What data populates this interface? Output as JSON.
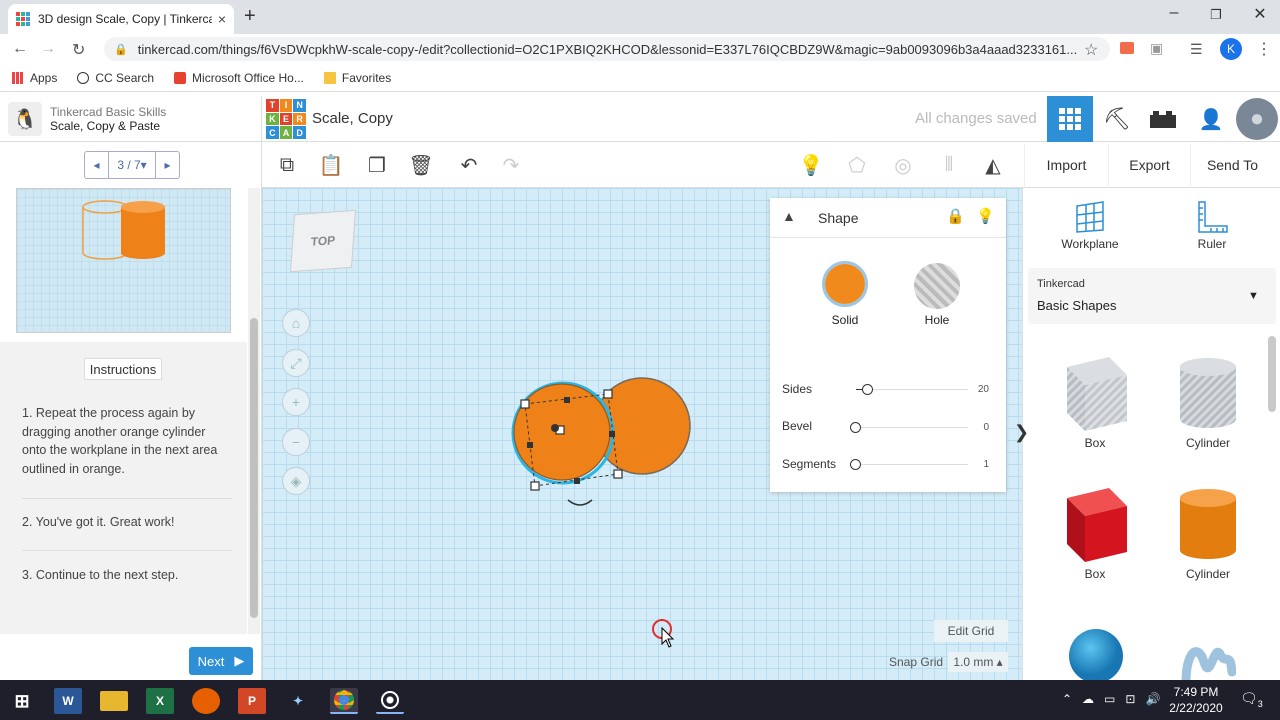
{
  "browser": {
    "tab_title": "3D design Scale, Copy | Tinkercad",
    "tab_close": "×",
    "new_tab": "+",
    "url": "tinkercad.com/things/f6VsDWcpkhW-scale-copy-/edit?collectionid=O2C1PXBIQ2KHCOD&lessonid=E337L76IQCBDZ9W&magic=9ab0093096b3a4aaad3233161...",
    "profile_initial": "K",
    "bookmarks": [
      "Apps",
      "CC Search",
      "Microsoft Office Ho...",
      "Favorites"
    ],
    "win_min": "–",
    "win_max": "❐",
    "win_close": "✕"
  },
  "lesson": {
    "course": "Tinkercad Basic Skills",
    "title": "Scale, Copy & Paste",
    "pager": "3 / 7▾",
    "pager_prev": "◂",
    "pager_next": "▸",
    "instructions_label": "Instructions",
    "steps": [
      "1. Repeat the process again by dragging another orange cylinder onto the workplane in the next area outlined in orange.",
      "2. You've got it. Great work!",
      "3. Continue to the next step."
    ],
    "next_label": "Next"
  },
  "header": {
    "logo_letters": [
      "T",
      "I",
      "N",
      "K",
      "E",
      "R",
      "C",
      "A",
      "D"
    ],
    "design_title": "Scale, Copy",
    "save_status": "All changes saved"
  },
  "toolbar": {
    "import": "Import",
    "export": "Export",
    "send_to": "Send To"
  },
  "workplane": {
    "view_cube": "TOP",
    "edit_grid": "Edit Grid",
    "snap_grid_label": "Snap Grid",
    "snap_grid_value": "1.0 mm ▴"
  },
  "inspector": {
    "title": "Shape",
    "solid": "Solid",
    "hole": "Hole",
    "solid_color": "#f08a1d",
    "props": [
      {
        "label": "Sides",
        "value": "20",
        "fraction": 0.1
      },
      {
        "label": "Bevel",
        "value": "0",
        "fraction": 0.0
      },
      {
        "label": "Segments",
        "value": "1",
        "fraction": 0.0
      }
    ]
  },
  "right_panel": {
    "workplane": "Workplane",
    "ruler": "Ruler",
    "library_group": "Tinkercad",
    "library_name": "Basic Shapes",
    "shapes": [
      "Box",
      "Cylinder",
      "Box",
      "Cylinder"
    ]
  },
  "taskbar": {
    "time": "7:49 PM",
    "date": "2/22/2020",
    "notif_count": "3"
  }
}
